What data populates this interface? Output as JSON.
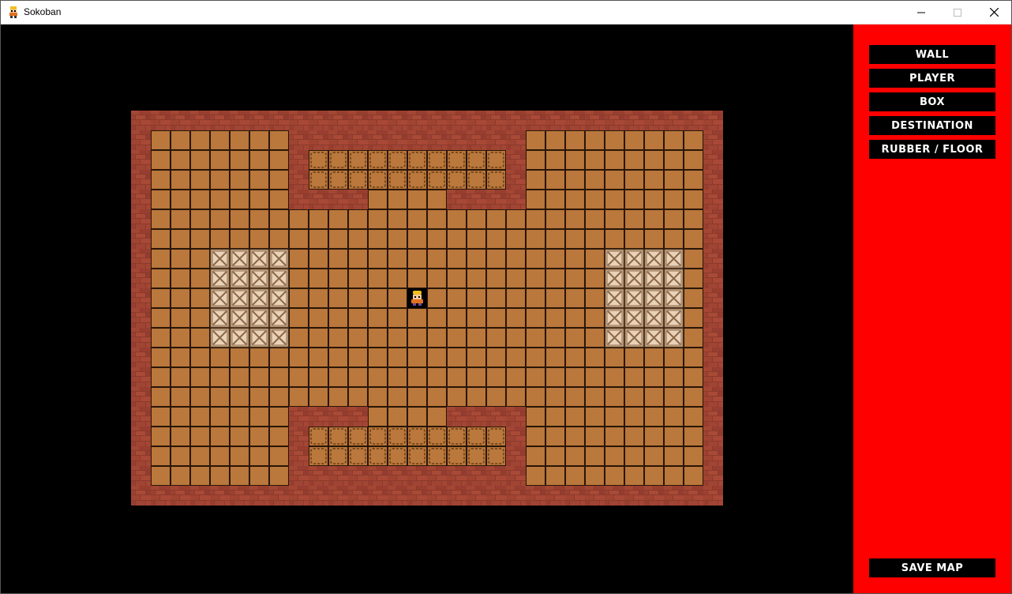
{
  "window": {
    "title": "Sokoban",
    "controls": {
      "minimize": "─",
      "maximize": "☐",
      "close": "✕"
    }
  },
  "toolbar": {
    "buttons": [
      {
        "id": "wall",
        "label": "WALL"
      },
      {
        "id": "player",
        "label": "PLAYER"
      },
      {
        "id": "box",
        "label": "BOX"
      },
      {
        "id": "destination",
        "label": "DESTINATION"
      },
      {
        "id": "rubber",
        "label": "RUBBER / FLOOR"
      }
    ],
    "save_label": "SAVE MAP"
  },
  "colors": {
    "sidebar": "#ff0000",
    "floor": "#b8763a",
    "wall": "#8c3a2c",
    "box": "#e0c2a6"
  },
  "map": {
    "legend": {
      "W": "wall",
      "F": "floor",
      "B": "box",
      "D": "destination",
      "P": "player"
    },
    "rows": [
      "WWWWWWWWWWWWWWWWWWWWWWWWWWWWWW",
      "WFFFFFFFWWWWWWWWWWWWFFFFFFFFFW",
      "WFFFFFFFWDDDDDDDDDDWFFFFFFFFFW",
      "WFFFFFFFWDDDDDDDDDDWFFFFFFFFFW",
      "WFFFFFFFWWWWFFFFWWWWFFFFFFFFFW",
      "WFFFFFFFFFFFFFFFFFFFFFFFFFFFFW",
      "WFFFFFFFFFFFFFFFFFFFFFFFFFFFFW",
      "WFFFBBBBFFFFFFFFFFFFFFFFBBBBFW",
      "WFFFBBBBFFFFFFFFFFFFFFFFBBBBFW",
      "WFFFBBBBFFFFFFPFFFFFFFFFBBBBFW",
      "WFFFBBBBFFFFFFFFFFFFFFFFBBBBFW",
      "WFFFBBBBFFFFFFFFFFFFFFFFBBBBFW",
      "WFFFFFFFFFFFFFFFFFFFFFFFFFFFFW",
      "WFFFFFFFFFFFFFFFFFFFFFFFFFFFFW",
      "WFFFFFFFFFFFFFFFFFFFFFFFFFFFFW",
      "WFFFFFFFWWWWFFFFWWWWFFFFFFFFFW",
      "WFFFFFFFWDDDDDDDDDDWFFFFFFFFFW",
      "WFFFFFFFWDDDDDDDDDDWFFFFFFFFFW",
      "WFFFFFFFWWWWWWWWWWWWFFFFFFFFFW",
      "WWWWWWWWWWWWWWWWWWWWWWWWWWWWWW"
    ]
  }
}
